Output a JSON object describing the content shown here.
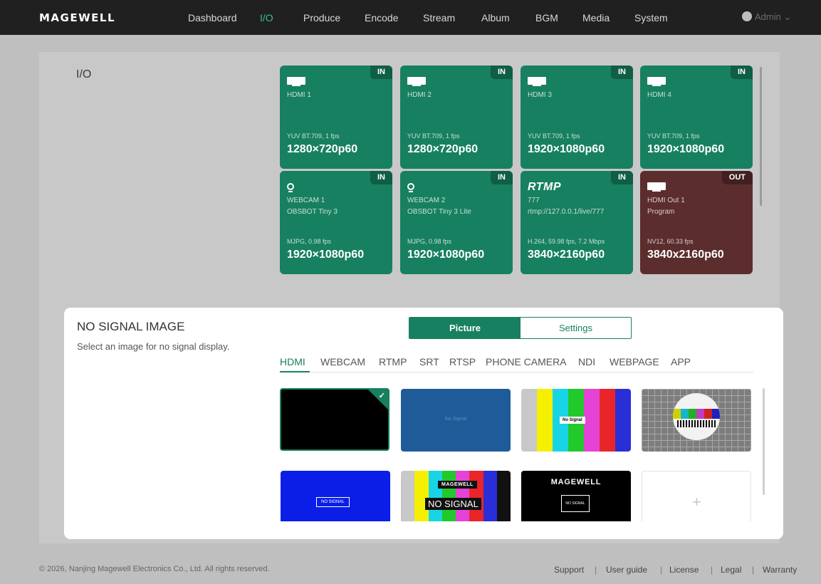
{
  "app": {
    "logo": "MAGEWELL",
    "nav": [
      "Dashboard",
      "I/O",
      "Produce",
      "Encode",
      "Stream",
      "Album",
      "BGM",
      "Media",
      "System"
    ],
    "active_nav": "I/O",
    "user": "Admin"
  },
  "io": {
    "title": "I/O",
    "cards": [
      {
        "icon": "hdmi-icon",
        "badge": "IN",
        "name1": "HDMI 1",
        "name2": "",
        "format": "YUV BT.709, 1 fps",
        "resolution": "1280×720p60",
        "color": "#178060"
      },
      {
        "icon": "hdmi-icon",
        "badge": "IN",
        "name1": "HDMI 2",
        "name2": "",
        "format": "YUV BT.709, 1 fps",
        "resolution": "1280×720p60",
        "color": "#178060"
      },
      {
        "icon": "hdmi-icon",
        "badge": "IN",
        "name1": "HDMI 3",
        "name2": "",
        "format": "YUV BT.709, 1 fps",
        "resolution": "1920×1080p60",
        "color": "#178060"
      },
      {
        "icon": "hdmi-icon",
        "badge": "IN",
        "name1": "HDMI 4",
        "name2": "",
        "format": "YUV BT.709, 1 fps",
        "resolution": "1920×1080p60",
        "color": "#178060"
      },
      {
        "icon": "webcam-icon",
        "badge": "IN",
        "name1": "WEBCAM 1",
        "name2": "OBSBOT Tiny 3",
        "format": "MJPG, 0.98 fps",
        "resolution": "1920×1080p60",
        "color": "#178060"
      },
      {
        "icon": "webcam-icon",
        "badge": "IN",
        "name1": "WEBCAM 2",
        "name2": "OBSBOT Tiny 3 Lite",
        "format": "MJPG, 0.98 fps",
        "resolution": "1920×1080p60",
        "color": "#178060"
      },
      {
        "icon": "rtmp-icon",
        "icon_text": "RTMP",
        "badge": "IN",
        "name1": "777",
        "name2": "rtmp://127.0.0.1/live/777",
        "format": "H.264, 59.98 fps, 7.2 Mbps",
        "resolution": "3840×2160p60",
        "color": "#178060"
      },
      {
        "icon": "hdmi-icon",
        "badge": "OUT",
        "name1": "HDMI Out 1",
        "name2": "Program",
        "format": "NV12, 60.33 fps",
        "resolution": "3840x2160p60",
        "color": "#5c2d2d"
      }
    ]
  },
  "modal": {
    "title": "NO SIGNAL IMAGE",
    "description": "Select an image for no signal display.",
    "segments": [
      "Picture",
      "Settings"
    ],
    "active_segment": "Picture",
    "source_tabs": [
      "HDMI",
      "WEBCAM",
      "RTMP",
      "SRT",
      "RTSP",
      "PHONE CAMERA",
      "NDI",
      "WEBPAGE",
      "APP"
    ],
    "active_source_tab": "HDMI",
    "thumbnails": [
      {
        "kind": "black",
        "selected": true,
        "label": ""
      },
      {
        "kind": "blue-text",
        "selected": false,
        "label": "No Signal"
      },
      {
        "kind": "color-bars",
        "selected": false,
        "label": "No Signal"
      },
      {
        "kind": "test-card",
        "selected": false,
        "label": ""
      },
      {
        "kind": "blue-box",
        "selected": false,
        "label": "NO SIGNAL"
      },
      {
        "kind": "bars-magewell",
        "selected": false,
        "label": "NO SIGNAL",
        "logo": "MAGEWELL"
      },
      {
        "kind": "black-magewell",
        "selected": false,
        "label": "NO SIGNAL",
        "logo": "MAGEWELL"
      },
      {
        "kind": "add",
        "selected": false,
        "label": "+"
      }
    ]
  },
  "footer": {
    "copyright": "© 2026, Nanjing Magewell Electronics Co., Ltd. All rights reserved.",
    "links": [
      "Support",
      "User guide",
      "License",
      "Legal",
      "Warranty"
    ]
  },
  "colors": {
    "accent": "#178060",
    "out_card": "#5c2d2d",
    "nav_active": "#3fbf8f"
  }
}
